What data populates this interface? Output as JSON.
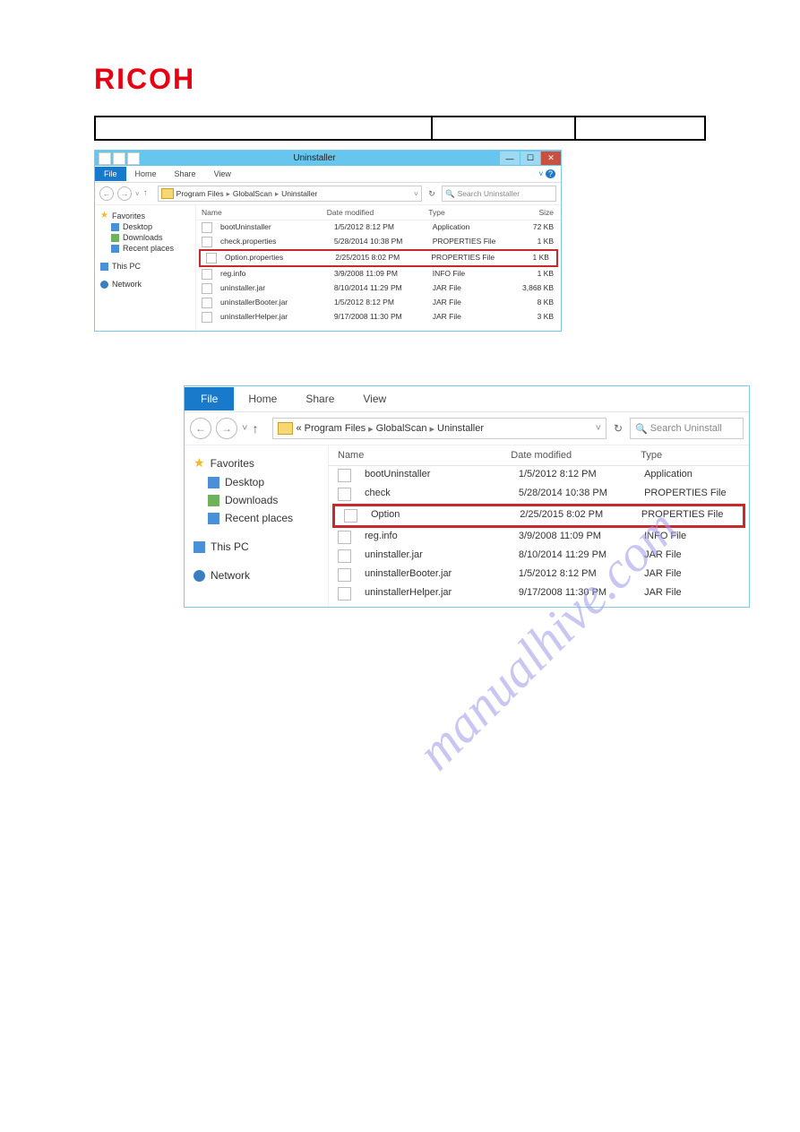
{
  "logo": "RICOH",
  "watermark": "manualhive.com",
  "win1": {
    "title": "Uninstaller",
    "tabs": {
      "file": "File",
      "home": "Home",
      "share": "Share",
      "view": "View"
    },
    "crumb": [
      "Program Files",
      "GlobalScan",
      "Uninstaller"
    ],
    "searchPlaceholder": "Search Uninstaller",
    "cols": {
      "name": "Name",
      "date": "Date modified",
      "type": "Type",
      "size": "Size"
    },
    "nav": {
      "favorites": "Favorites",
      "desktop": "Desktop",
      "downloads": "Downloads",
      "recent": "Recent places",
      "thispc": "This PC",
      "network": "Network"
    },
    "rows": [
      {
        "name": "bootUninstaller",
        "date": "1/5/2012 8:12 PM",
        "type": "Application",
        "size": "72 KB"
      },
      {
        "name": "check.properties",
        "date": "5/28/2014 10:38 PM",
        "type": "PROPERTIES File",
        "size": "1 KB"
      },
      {
        "name": "Option.properties",
        "date": "2/25/2015 8:02 PM",
        "type": "PROPERTIES File",
        "size": "1 KB"
      },
      {
        "name": "reg.info",
        "date": "3/9/2008 11:09 PM",
        "type": "INFO File",
        "size": "1 KB"
      },
      {
        "name": "uninstaller.jar",
        "date": "8/10/2014 11:29 PM",
        "type": "JAR File",
        "size": "3,868 KB"
      },
      {
        "name": "uninstallerBooter.jar",
        "date": "1/5/2012 8:12 PM",
        "type": "JAR File",
        "size": "8 KB"
      },
      {
        "name": "uninstallerHelper.jar",
        "date": "9/17/2008 11:30 PM",
        "type": "JAR File",
        "size": "3 KB"
      }
    ]
  },
  "win2": {
    "tabs": {
      "file": "File",
      "home": "Home",
      "share": "Share",
      "view": "View"
    },
    "crumbPrefix": "«",
    "crumb": [
      "Program Files",
      "GlobalScan",
      "Uninstaller"
    ],
    "searchPlaceholder": "Search Uninstall",
    "cols": {
      "name": "Name",
      "date": "Date modified",
      "type": "Type"
    },
    "nav": {
      "favorites": "Favorites",
      "desktop": "Desktop",
      "downloads": "Downloads",
      "recent": "Recent places",
      "thispc": "This PC",
      "network": "Network"
    },
    "rows": [
      {
        "name": "bootUninstaller",
        "date": "1/5/2012 8:12 PM",
        "type": "Application"
      },
      {
        "name": "check",
        "date": "5/28/2014 10:38 PM",
        "type": "PROPERTIES File"
      },
      {
        "name": "Option",
        "date": "2/25/2015 8:02 PM",
        "type": "PROPERTIES File"
      },
      {
        "name": "reg.info",
        "date": "3/9/2008 11:09 PM",
        "type": "INFO File"
      },
      {
        "name": "uninstaller.jar",
        "date": "8/10/2014 11:29 PM",
        "type": "JAR File"
      },
      {
        "name": "uninstallerBooter.jar",
        "date": "1/5/2012 8:12 PM",
        "type": "JAR File"
      },
      {
        "name": "uninstallerHelper.jar",
        "date": "9/17/2008 11:30 PM",
        "type": "JAR File"
      }
    ]
  }
}
